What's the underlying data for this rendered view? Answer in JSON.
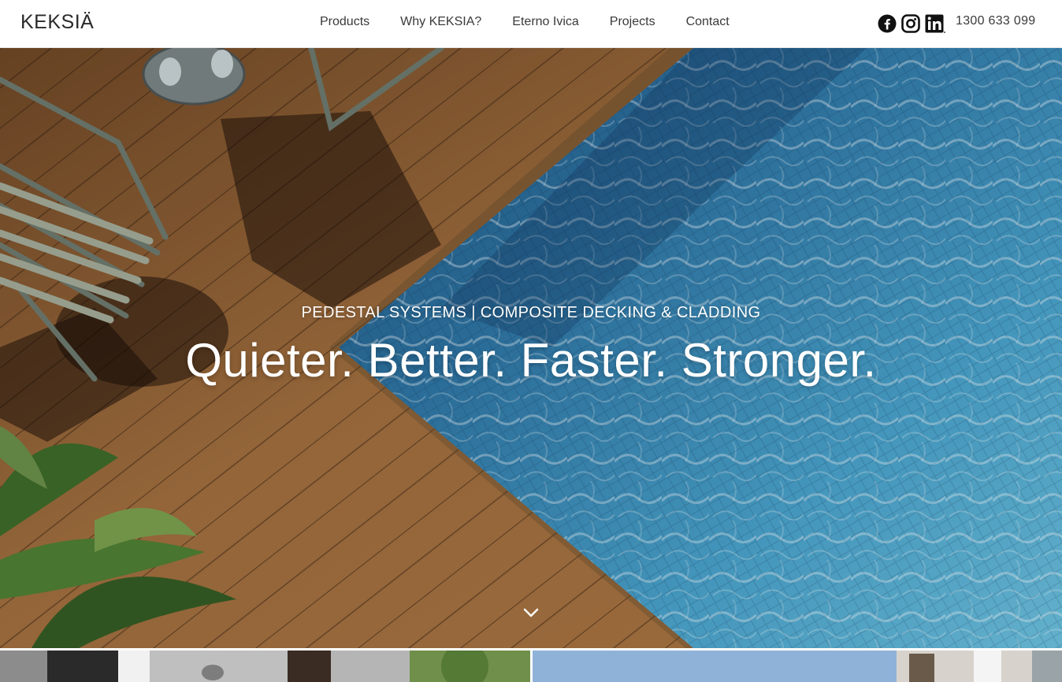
{
  "header": {
    "logo": "KEKSIÄ",
    "nav": [
      {
        "label": "Products"
      },
      {
        "label": "Why KEKSIA?"
      },
      {
        "label": "Eterno Ivica"
      },
      {
        "label": "Projects"
      },
      {
        "label": "Contact"
      }
    ],
    "social": [
      {
        "icon": "facebook-icon"
      },
      {
        "icon": "instagram-icon"
      },
      {
        "icon": "linkedin-icon"
      }
    ],
    "phone": "1300 633 099"
  },
  "hero": {
    "subtitle": "PEDESTAL SYSTEMS | COMPOSITE DECKING & CLADDING",
    "title": "Quieter. Better. Faster. Stronger.",
    "scroll_icon": "chevron-down-icon"
  },
  "colors": {
    "header_bg": "#ffffff",
    "text": "#3a3a3a",
    "hero_text": "#ffffff",
    "deck_wood": "#9a6a3c",
    "pool_water": "#3f8fb8"
  }
}
